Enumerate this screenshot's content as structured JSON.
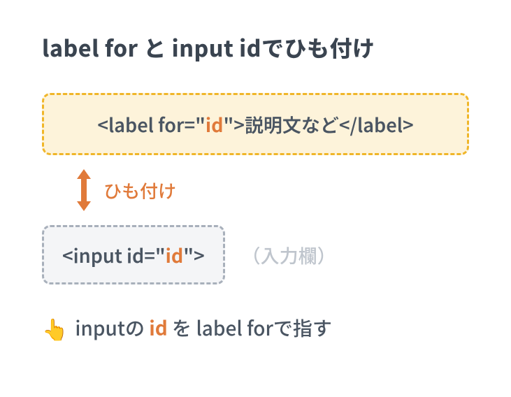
{
  "title": "label for と input idでひも付け",
  "label_box": {
    "open_tag_pre": "<label for=\"",
    "id_text": "id",
    "open_tag_post": "\">",
    "body": "説明文など",
    "close_tag": "</label>"
  },
  "connector": {
    "label": "ひも付け"
  },
  "input_box": {
    "open_tag_pre": "<input id=\"",
    "id_text": "id",
    "open_tag_post": "\">",
    "placeholder": "（入力欄）"
  },
  "footnote": {
    "pre": "inputの",
    "id": "id",
    "post": "を label forで指す"
  },
  "colors": {
    "accent_orange": "#e07a3a",
    "label_border": "#f0b629",
    "label_bg": "#fdf3da",
    "input_border": "#a8b0bb",
    "input_bg": "#f4f5f7"
  }
}
